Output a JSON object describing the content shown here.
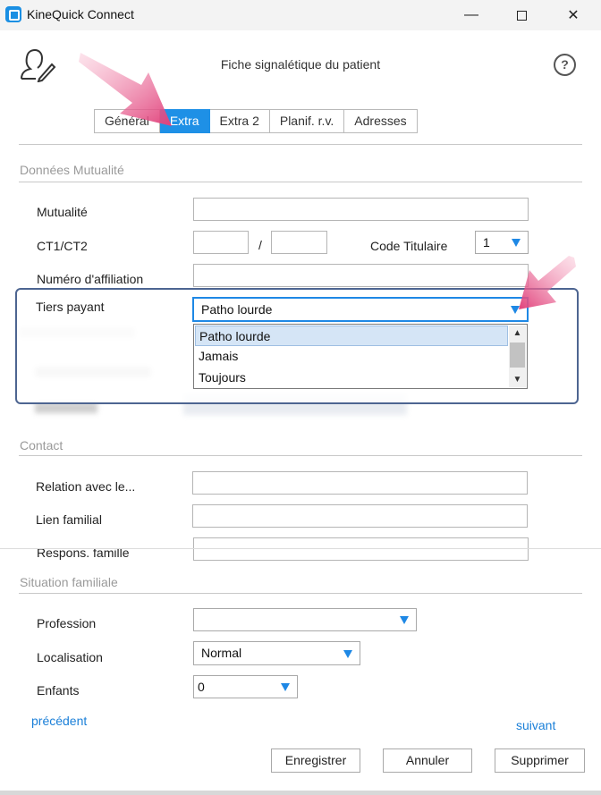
{
  "window": {
    "title": "KineQuick Connect",
    "minimize": "—",
    "maximize": "",
    "close": "✕"
  },
  "header": {
    "title": "Fiche signalétique du patient",
    "help": "?"
  },
  "tabs": [
    "Général",
    "Extra",
    "Extra 2",
    "Planif. r.v.",
    "Adresses"
  ],
  "active_tab": "Extra",
  "sections": {
    "mutualite": {
      "title": "Données Mutualité",
      "mutualite_label": "Mutualité",
      "mutualite_value": "",
      "ct_label": "CT1/CT2",
      "ct_separator": "/",
      "ct1_value": "",
      "ct2_value": "",
      "code_titulaire_label": "Code Titulaire",
      "code_titulaire_value": "1",
      "affiliation_label": "Numéro d'affiliation",
      "affiliation_value": "",
      "tiers_payant_label": "Tiers payant",
      "tiers_payant_value": "Patho lourde",
      "tiers_payant_options": [
        "Patho lourde",
        "Jamais",
        "Toujours"
      ]
    },
    "contact": {
      "title": "Contact",
      "relation_label": "Relation avec le...",
      "relation_value": "",
      "lien_label": "Lien familial",
      "lien_value": "",
      "respons_label": "Respons. famille",
      "respons_value": ""
    },
    "situation": {
      "title": "Situation familiale",
      "profession_label": "Profession",
      "profession_value": "",
      "localisation_label": "Localisation",
      "localisation_value": "Normal",
      "enfants_label": "Enfants",
      "enfants_value": "0"
    }
  },
  "nav": {
    "previous": "précédent",
    "next": "suivant"
  },
  "actions": {
    "save": "Enregistrer",
    "cancel": "Annuler",
    "delete": "Supprimer"
  },
  "colors": {
    "accent": "#1e90e6",
    "annotation_arrow": "#e0407a",
    "focus_frame": "#4d6591"
  }
}
